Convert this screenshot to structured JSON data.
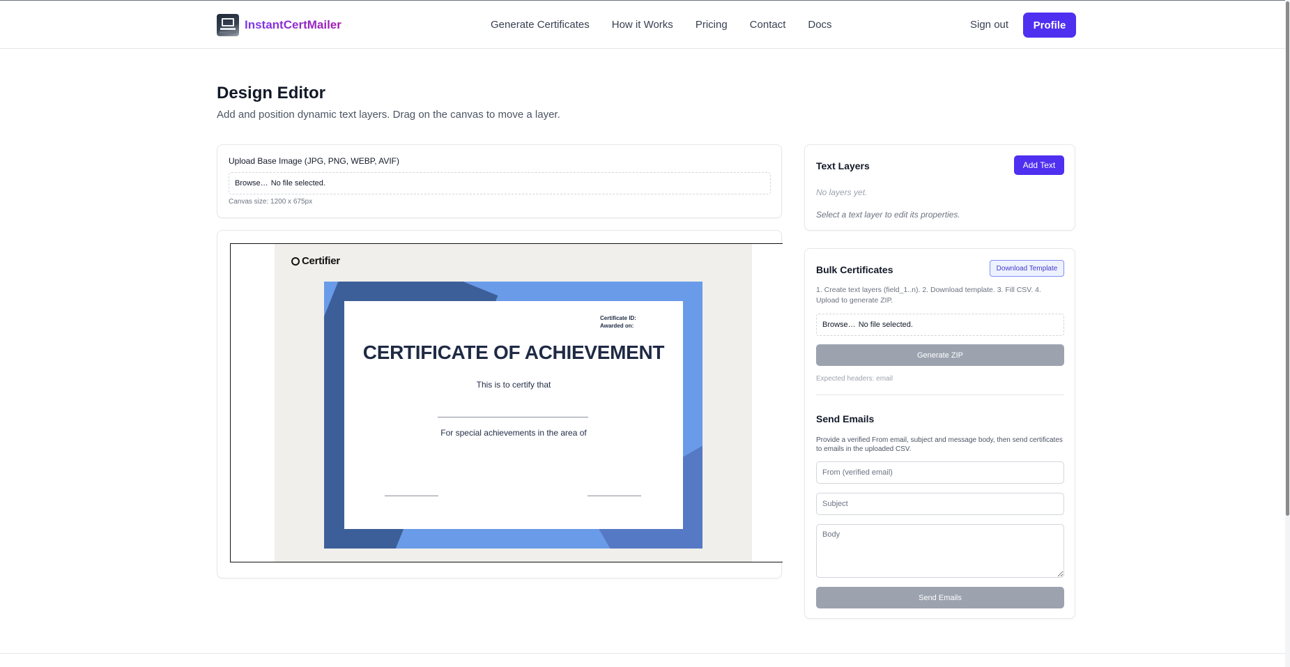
{
  "header": {
    "brand": "InstantCertMailer",
    "nav": [
      "Generate Certificates",
      "How it Works",
      "Pricing",
      "Contact",
      "Docs"
    ],
    "sign_out": "Sign out",
    "profile": "Profile"
  },
  "page": {
    "title": "Design Editor",
    "subtitle": "Add and position dynamic text layers. Drag on the canvas to move a layer."
  },
  "upload": {
    "label": "Upload Base Image (JPG, PNG, WEBP, AVIF)",
    "browse": "Browse…",
    "file_status": "No file selected.",
    "canvas_size": "Canvas size: 1200 x 675px"
  },
  "certificate": {
    "logo": "Certifier",
    "meta_id": "Certificate ID:",
    "meta_awarded": "Awarded on:",
    "heading": "CERTIFICATE OF ACHIEVEMENT",
    "certify": "This is to certify that",
    "area": "For special achievements in the area of"
  },
  "text_layers": {
    "title": "Text Layers",
    "add_button": "Add Text",
    "empty": "No layers yet.",
    "hint": "Select a text layer to edit its properties."
  },
  "bulk": {
    "title": "Bulk Certificates",
    "download_template": "Download Template",
    "description": "1. Create text layers (field_1..n). 2. Download template. 3. Fill CSV. 4. Upload to generate ZIP.",
    "browse": "Browse…",
    "file_status": "No file selected.",
    "generate_zip": "Generate ZIP",
    "expected_headers": "Expected headers: email"
  },
  "send_emails": {
    "title": "Send Emails",
    "description": "Provide a verified From email, subject and message body, then send certificates to emails in the uploaded CSV.",
    "from_placeholder": "From (verified email)",
    "subject_placeholder": "Subject",
    "body_placeholder": "Body",
    "send_button": "Send Emails"
  },
  "colors": {
    "accent": "#4f2ff0",
    "brand_gradient_start": "#7c3aed",
    "brand_gradient_end": "#a21caf",
    "disabled_button": "#9ca3af"
  }
}
